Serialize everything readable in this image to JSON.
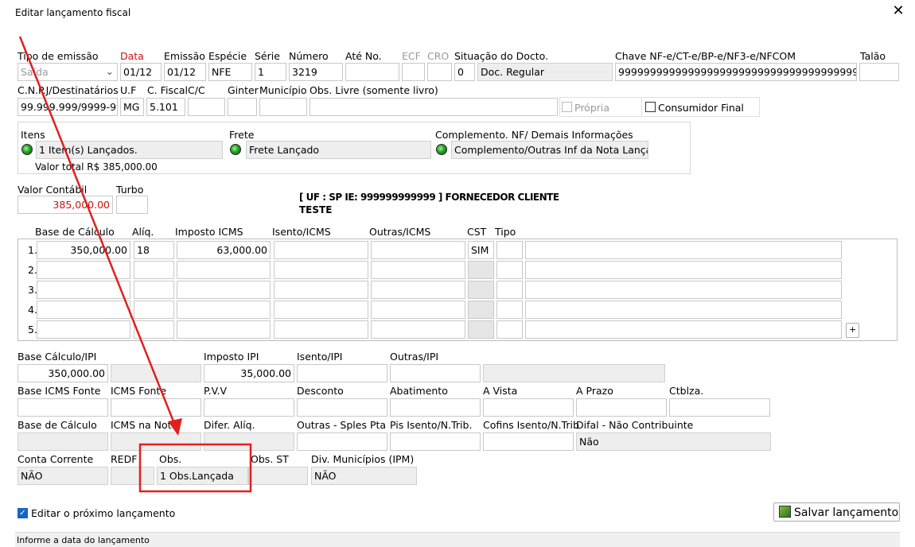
{
  "window": {
    "title": "Editar lançamento fiscal",
    "close_glyph": "✕"
  },
  "header": {
    "tipo_emissao": {
      "label": "Tipo de emissão",
      "value": "Saída"
    },
    "data": {
      "label": "Data",
      "value": "01/12"
    },
    "emissao": {
      "label": "Emissão",
      "value": "01/12"
    },
    "especie": {
      "label": "Espécie",
      "value": "NFE"
    },
    "serie": {
      "label": "Série",
      "value": "1"
    },
    "numero": {
      "label": "Número",
      "value": "3219"
    },
    "ate_no": {
      "label": "Até No.",
      "value": ""
    },
    "ecf": {
      "label": "ECF",
      "value": ""
    },
    "cro": {
      "label": "CRO",
      "value": ""
    },
    "situacao": {
      "label": "Situação do Docto.",
      "code": "0",
      "value": "Doc. Regular"
    },
    "chave": {
      "label": "Chave NF-e/CT-e/BP-e/NF3-e/NFCOM",
      "value": "9999999999999999999999999999999999999999999999"
    },
    "talao": {
      "label": "Talão",
      "value": ""
    },
    "cnpj": {
      "label": "C.N.P.J/Destinatários",
      "value": "99.999.999/9999-99"
    },
    "uf": {
      "label": "U.F",
      "value": "MG"
    },
    "cfiscal": {
      "label": "C. Fiscal",
      "value": "5.101"
    },
    "cc": {
      "label": "C/C",
      "value": ""
    },
    "ginter": {
      "label": "Ginter",
      "value": ""
    },
    "municipio": {
      "label": "Município",
      "value": ""
    },
    "obs_livre": {
      "label": "Obs. Livre (somente livro)",
      "value": ""
    },
    "propria": {
      "label": "Própria"
    },
    "consumidor_final": {
      "label": "Consumidor Final"
    }
  },
  "summary": {
    "itens": {
      "label": "Itens",
      "value": "1 Item(s) Lançados."
    },
    "frete": {
      "label": "Frete",
      "value": "Frete Lançado"
    },
    "complemento": {
      "label": "Complemento. NF/ Demais Informações",
      "value": "Complemento/Outras Inf da Nota Lançad"
    },
    "valor_total": "Valor total R$ 385,000.00"
  },
  "valor_contabil": {
    "label": "Valor Contábil",
    "value": "385,000.00"
  },
  "turbo": {
    "label": "Turbo",
    "value": ""
  },
  "fornecedor": {
    "line1": "[ UF : SP IE: 999999999999 ] FORNECEDOR CLIENTE",
    "line2": "TESTE"
  },
  "icms_grid": {
    "headers": [
      "Base de Cálculo",
      "Alíq.",
      "Imposto ICMS",
      "Isento/ICMS",
      "Outras/ICMS",
      "CST",
      "Tipo"
    ],
    "rows": [
      {
        "n": "1.",
        "base": "350,000.00",
        "aliq": "18",
        "imposto": "63,000.00",
        "isento": "",
        "outras": "",
        "cst": "SIM",
        "tipo": ""
      },
      {
        "n": "2.",
        "base": "",
        "aliq": "",
        "imposto": "",
        "isento": "",
        "outras": "",
        "cst": "",
        "tipo": ""
      },
      {
        "n": "3.",
        "base": "",
        "aliq": "",
        "imposto": "",
        "isento": "",
        "outras": "",
        "cst": "",
        "tipo": ""
      },
      {
        "n": "4.",
        "base": "",
        "aliq": "",
        "imposto": "",
        "isento": "",
        "outras": "",
        "cst": "",
        "tipo": ""
      },
      {
        "n": "5.",
        "base": "",
        "aliq": "",
        "imposto": "",
        "isento": "",
        "outras": "",
        "cst": "",
        "tipo": ""
      }
    ],
    "add_label": "+"
  },
  "ipi": {
    "base_calculo_ipi": {
      "label": "Base Cálculo/IPI",
      "value": "350,000.00"
    },
    "imposto_ipi": {
      "label": "Imposto IPI",
      "value": "35,000.00"
    },
    "isento_ipi": {
      "label": "Isento/IPI",
      "value": ""
    },
    "outras_ipi": {
      "label": "Outras/IPI",
      "value": ""
    }
  },
  "row2": {
    "base_icms_fonte": "Base ICMS Fonte",
    "icms_fonte": "ICMS Fonte",
    "pvv": "P.V.V",
    "desconto": "Desconto",
    "abatimento": "Abatimento",
    "a_vista": "A Vista",
    "a_prazo": "A Prazo",
    "ctblza": "Ctblza."
  },
  "row3": {
    "base_calculo": "Base de Cálculo",
    "icms_na_nota": "ICMS na Nota",
    "difer_aliq": "Difer. Alíq.",
    "outras_sples": "Outras - Sples Pta",
    "pis_isento": "Pis Isento/N.Trib.",
    "cofins_isento": "Cofins Isento/N.Trib",
    "difal": {
      "label": "Difal - Não Contribuinte",
      "value": "Não"
    }
  },
  "row4": {
    "conta_corrente": {
      "label": "Conta Corrente",
      "value": "NÃO"
    },
    "redf": {
      "label": "REDF",
      "value": ""
    },
    "obs": {
      "label": "Obs.",
      "value": "1 Obs.Lançada"
    },
    "obs_st": {
      "label": "Obs. ST",
      "value": ""
    },
    "div_municipios": {
      "label": "Div. Municípios (IPM)",
      "value": "NÃO"
    }
  },
  "footer": {
    "editar_proximo": "Editar o próximo lançamento",
    "salvar": "Salvar lançamento",
    "status": "Informe a data do lançamento"
  },
  "colors": {
    "annotation": "#e02020",
    "required_label": "#d01010"
  }
}
